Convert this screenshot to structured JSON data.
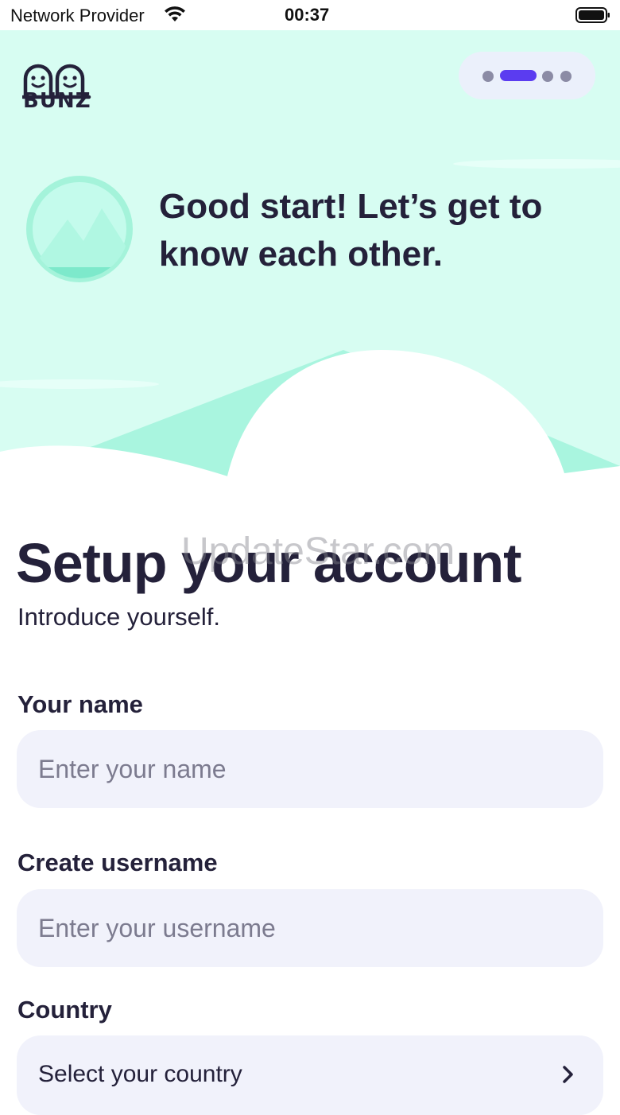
{
  "status_bar": {
    "carrier": "Network Provider",
    "time": "00:37"
  },
  "brand": {
    "logo_text": "BUNZ"
  },
  "onboarding": {
    "steps_total": 4,
    "current_step": 2
  },
  "hero": {
    "heading": "Good start! Let’s get to know each other."
  },
  "form": {
    "title": "Setup your account",
    "subtitle": "Introduce yourself.",
    "name": {
      "label": "Your name",
      "placeholder": "Enter your name",
      "value": ""
    },
    "username": {
      "label": "Create username",
      "placeholder": "Enter your username",
      "value": ""
    },
    "country": {
      "label": "Country",
      "value": "Select your country"
    }
  },
  "watermark": "UpdateStar.com",
  "colors": {
    "hero_background": "#d7fdf2",
    "accent": "#5b3cf0",
    "input_background": "#f1f2fb",
    "text_primary": "#24213a",
    "placeholder": "#7c7b8f"
  },
  "icons": {
    "wifi": "wifi-icon",
    "battery": "battery-icon",
    "mountain": "mountain-icon",
    "chevron": "chevron-right-icon"
  }
}
